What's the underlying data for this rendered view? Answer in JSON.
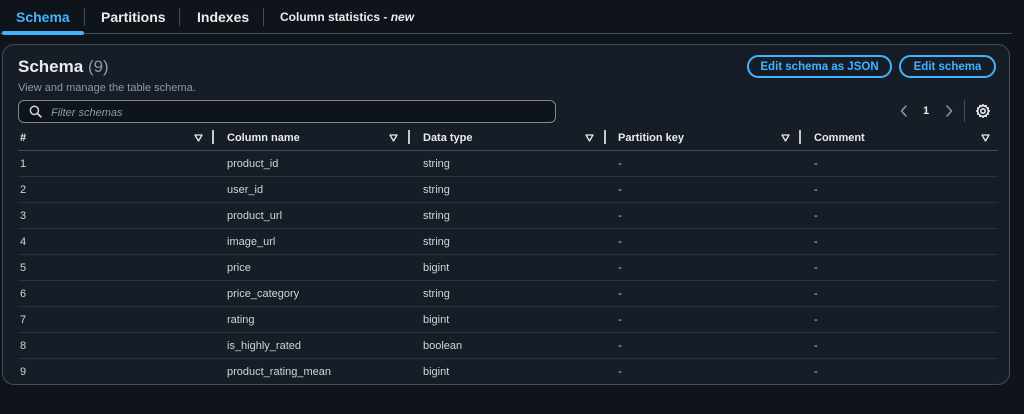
{
  "tabs": [
    {
      "label": "Schema",
      "active": true
    },
    {
      "label": "Partitions"
    },
    {
      "label": "Indexes"
    },
    {
      "label": "Column statistics - ",
      "suffix": "new"
    }
  ],
  "schema": {
    "title": "Schema",
    "count": "(9)",
    "description": "View and manage the table schema.",
    "edit_json_label": "Edit schema as JSON",
    "edit_label": "Edit schema"
  },
  "search": {
    "placeholder": "Filter schemas",
    "value": ""
  },
  "pagination": {
    "current_page": "1"
  },
  "table": {
    "columns": [
      "#",
      "Column name",
      "Data type",
      "Partition key",
      "Comment"
    ],
    "rows": [
      {
        "num": "1",
        "name": "product_id",
        "type": "string",
        "partition": "-",
        "comment": "-"
      },
      {
        "num": "2",
        "name": "user_id",
        "type": "string",
        "partition": "-",
        "comment": "-"
      },
      {
        "num": "3",
        "name": "product_url",
        "type": "string",
        "partition": "-",
        "comment": "-"
      },
      {
        "num": "4",
        "name": "image_url",
        "type": "string",
        "partition": "-",
        "comment": "-"
      },
      {
        "num": "5",
        "name": "price",
        "type": "bigint",
        "partition": "-",
        "comment": "-"
      },
      {
        "num": "6",
        "name": "price_category",
        "type": "string",
        "partition": "-",
        "comment": "-"
      },
      {
        "num": "7",
        "name": "rating",
        "type": "bigint",
        "partition": "-",
        "comment": "-"
      },
      {
        "num": "8",
        "name": "is_highly_rated",
        "type": "boolean",
        "partition": "-",
        "comment": "-"
      },
      {
        "num": "9",
        "name": "product_rating_mean",
        "type": "bigint",
        "partition": "-",
        "comment": "-"
      }
    ]
  },
  "colors": {
    "accent": "#42b4ff",
    "background": "#0f141a",
    "panel": "#161d26",
    "border": "#414d5c"
  },
  "icons": {
    "search": "search-icon",
    "sort": "caret-down-icon",
    "prev": "chevron-left-icon",
    "next": "chevron-right-icon",
    "settings": "gear-icon"
  }
}
